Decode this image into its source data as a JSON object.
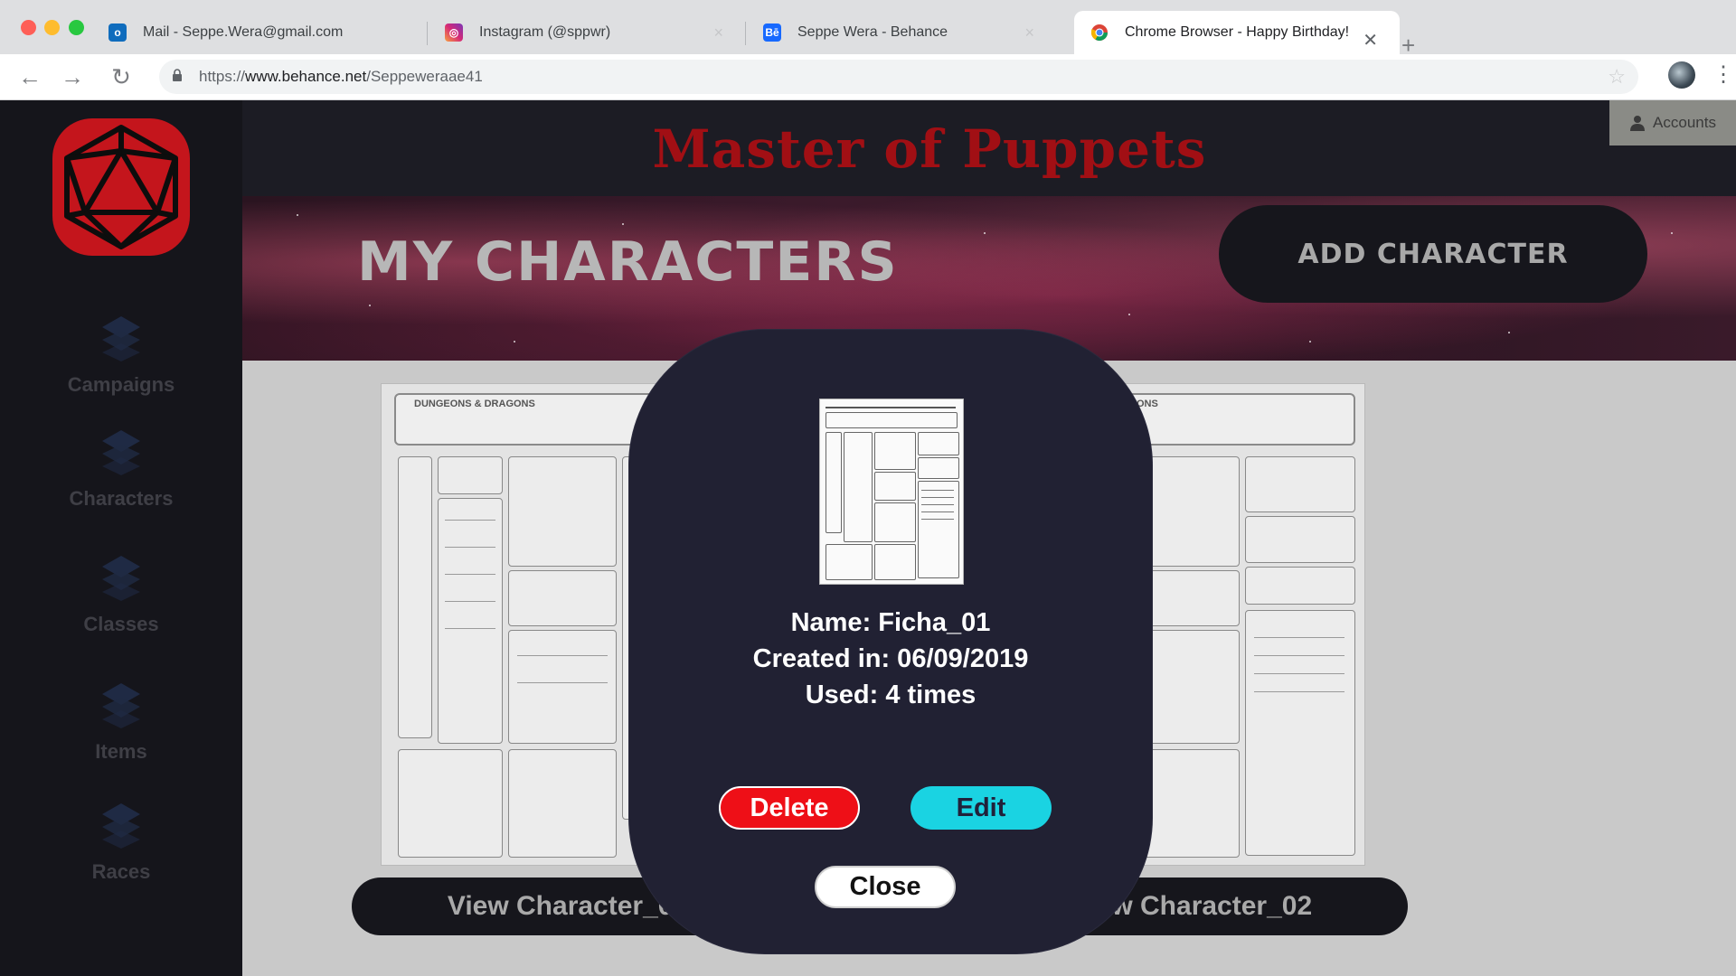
{
  "browser": {
    "tabs": [
      {
        "title": "Mail - Seppe.Wera@gmail.com",
        "icon": "outlook-icon"
      },
      {
        "title": "Instagram (@sppwr)",
        "icon": "instagram-icon"
      },
      {
        "title": "Seppe Wera - Behance",
        "icon": "behance-icon"
      },
      {
        "title": "Chrome Browser - Happy Birthday!",
        "icon": "chrome-icon",
        "active": true
      }
    ],
    "url_prefix": "https://",
    "url_domain": "www.behance.net",
    "url_path": "/Seppeweraae41"
  },
  "app": {
    "title": "Master of Puppets",
    "accounts_label": "Accounts",
    "sidebar": [
      {
        "label": "Campaigns"
      },
      {
        "label": "Characters"
      },
      {
        "label": "Classes"
      },
      {
        "label": "Items"
      },
      {
        "label": "Races"
      }
    ],
    "banner_title": "MY CHARACTERS",
    "add_character_label": "ADD CHARACTER",
    "sheet_brand": "DUNGEONS & DRAGONS",
    "cards": [
      {
        "view_label": "View Character_01"
      },
      {
        "view_label": "View Character_02"
      }
    ]
  },
  "modal": {
    "name_line": "Name: Ficha_01",
    "created_line": "Created in: 06/09/2019",
    "used_line": "Used: 4 times",
    "delete_label": "Delete",
    "edit_label": "Edit",
    "close_label": "Close"
  },
  "colors": {
    "title_red": "#a10f14",
    "delete_red": "#ee0f17",
    "edit_cyan": "#1ad3e2",
    "modal_bg": "#212133",
    "sidebar_bg": "#15151b"
  }
}
